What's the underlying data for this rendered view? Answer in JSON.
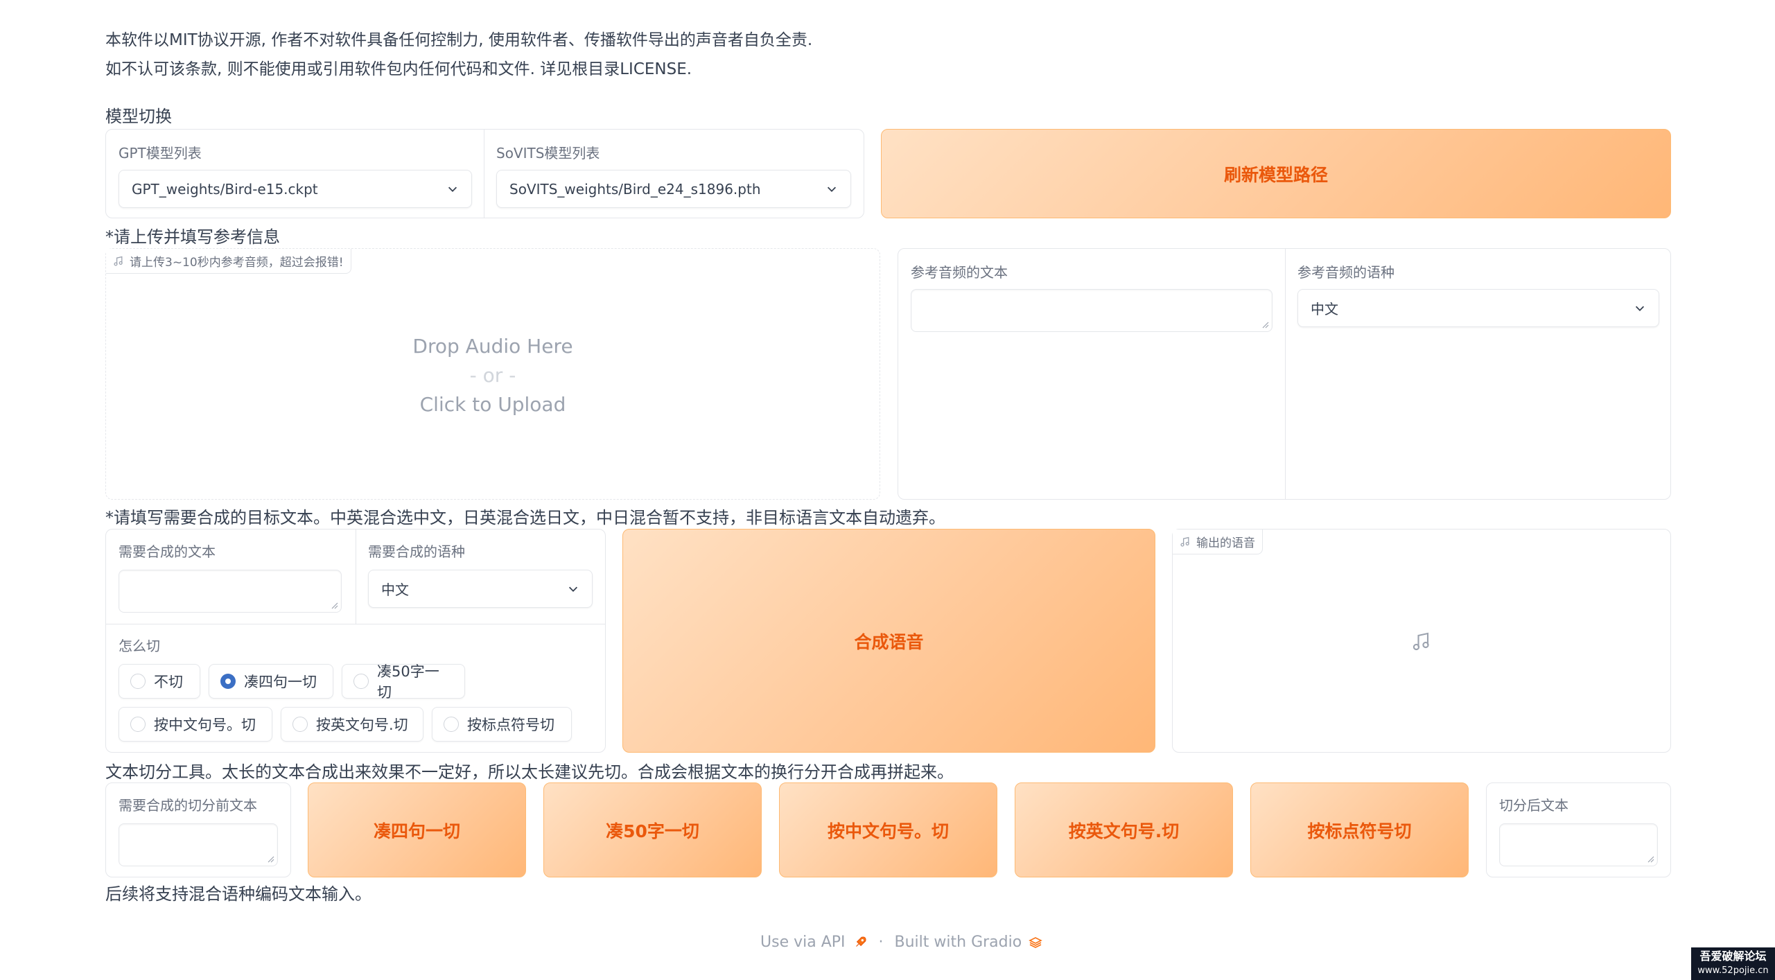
{
  "notice": {
    "line1": "本软件以MIT协议开源, 作者不对软件具备任何控制力, 使用软件者、传播软件导出的声音者自负全责.",
    "line2": "如不认可该条款, 则不能使用或引用软件包内任何代码和文件. 详见根目录LICENSE."
  },
  "model_switch": {
    "title": "模型切换",
    "gpt_label": "GPT模型列表",
    "gpt_value": "GPT_weights/Bird-e15.ckpt",
    "sovits_label": "SoVITS模型列表",
    "sovits_value": "SoVITS_weights/Bird_e24_s1896.pth",
    "refresh_button": "刷新模型路径"
  },
  "reference": {
    "title": "*请上传并填写参考信息",
    "audio_tag": "请上传3~10秒内参考音频，超过会报错!",
    "drop_line1": "Drop Audio Here",
    "drop_line2": "- or -",
    "drop_line3": "Click to Upload",
    "text_label": "参考音频的文本",
    "lang_label": "参考音频的语种",
    "lang_value": "中文"
  },
  "synthesis": {
    "title": "*请填写需要合成的目标文本。中英混合选中文，日英混合选日文，中日混合暂不支持，非目标语言文本自动遗弃。",
    "text_label": "需要合成的文本",
    "lang_label": "需要合成的语种",
    "lang_value": "中文",
    "cut_label": "怎么切",
    "cut_options": [
      "不切",
      "凑四句一切",
      "凑50字一切",
      "按中文句号。切",
      "按英文句号.切",
      "按标点符号切"
    ],
    "selected_cut": "凑四句一切",
    "synth_button": "合成语音",
    "output_tag": "输出的语音"
  },
  "cutter": {
    "title": "文本切分工具。太长的文本合成出来效果不一定好，所以太长建议先切。合成会根据文本的换行分开合成再拼起来。",
    "input_label": "需要合成的切分前文本",
    "buttons": [
      "凑四句一切",
      "凑50字一切",
      "按中文句号。切",
      "按英文句号.切",
      "按标点符号切"
    ],
    "output_label": "切分后文本"
  },
  "bottom_note": "后续将支持混合语种编码文本输入。",
  "footer": {
    "api": "Use via API",
    "sep": "·",
    "built": "Built with Gradio"
  },
  "watermark": {
    "line1": "吾爱破解论坛",
    "line2": "www.52pojie.cn"
  },
  "colors": {
    "accent_text": "#ea580c",
    "button_gradient_start": "#ffe1c4",
    "button_gradient_end": "#ffb777",
    "radio_selected": "#3b6fc4"
  }
}
